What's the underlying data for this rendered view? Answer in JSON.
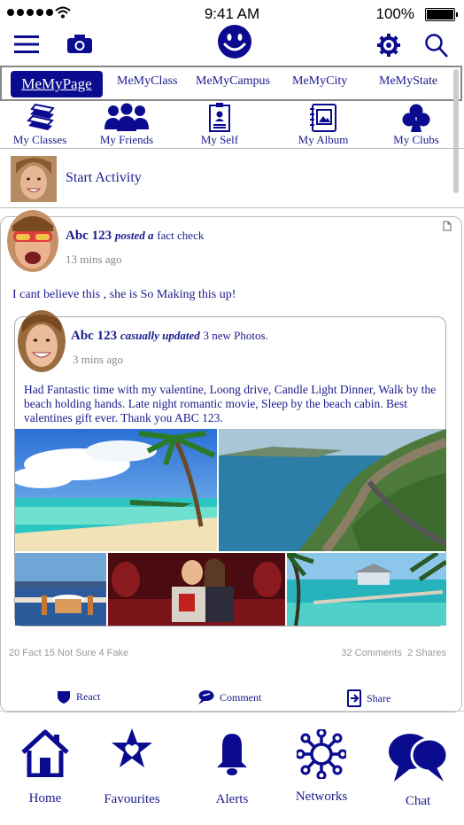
{
  "status_bar": {
    "time": "9:41 AM",
    "battery": "100%"
  },
  "header": {
    "menu_icon": "hamburger-icon",
    "camera_icon": "camera-icon",
    "logo_icon": "smiley-icon",
    "settings_icon": "gear-icon",
    "search_icon": "search-icon"
  },
  "tabs": [
    {
      "label": "MeMyPage",
      "active": true
    },
    {
      "label": "MeMyClass"
    },
    {
      "label": "MeMyCampus"
    },
    {
      "label": "MeMyCity"
    },
    {
      "label": "MeMyState"
    }
  ],
  "nav": [
    {
      "label": "My Classes",
      "icon": "books-icon"
    },
    {
      "label": "My Friends",
      "icon": "group-icon"
    },
    {
      "label": "My Self",
      "icon": "id-badge-icon"
    },
    {
      "label": "My Album",
      "icon": "album-icon"
    },
    {
      "label": "My Clubs",
      "icon": "club-icon"
    }
  ],
  "start_activity": {
    "label": "Start Activity"
  },
  "post": {
    "author": "Abc 123",
    "action": "posted a",
    "object": "fact check",
    "time": "13 mins ago",
    "text": "I cant believe this , she is So Making this up!",
    "shared": {
      "author": "Abc 123",
      "action": "casually updated",
      "object": "3 new Photos.",
      "time": "3 mins ago",
      "text": "Had Fantastic time with my valentine, Loong drive, Candle Light Dinner, Walk by the beach holding hands. Late night romantic movie, Sleep by the beach cabin. Best valentines gift ever. Thank you ABC 123."
    },
    "stats_left": "20 Fact 15 Not Sure 4 Fake",
    "stats_right": "32 Comments  2 Shares",
    "actions": [
      {
        "label": "React",
        "icon": "shield-icon"
      },
      {
        "label": "Comment",
        "icon": "comment-icon"
      },
      {
        "label": "Share",
        "icon": "share-icon"
      }
    ]
  },
  "bottom_nav": [
    {
      "label": "Home",
      "icon": "home-icon"
    },
    {
      "label": "Favourites",
      "icon": "star-heart-icon"
    },
    {
      "label": "Alerts",
      "icon": "bell-icon"
    },
    {
      "label": "Networks",
      "icon": "network-icon"
    },
    {
      "label": "Chat",
      "icon": "chat-icon"
    }
  ],
  "colors": {
    "brand": "#0b0b8f",
    "accent_text": "#1a1a8c"
  }
}
